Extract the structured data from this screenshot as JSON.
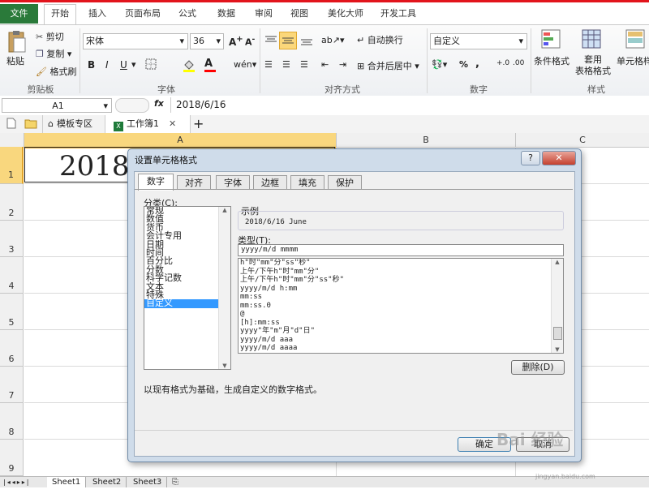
{
  "ribbon": {
    "tabs": [
      "文件",
      "开始",
      "插入",
      "页面布局",
      "公式",
      "数据",
      "审阅",
      "视图",
      "美化大师",
      "开发工具"
    ],
    "clipboard": {
      "paste": "粘贴",
      "cut": "剪切",
      "copy": "复制",
      "format_painter": "格式刷",
      "label": "剪贴板"
    },
    "font": {
      "name": "宋体",
      "size": "36",
      "bold": "B",
      "italic": "I",
      "underline": "U",
      "label": "字体"
    },
    "alignment": {
      "wrap": "自动换行",
      "merge": "合并后居中",
      "label": "对齐方式"
    },
    "number": {
      "format": "自定义",
      "percent": "%",
      "comma": ",",
      "label": "数字"
    },
    "styles": {
      "conditional": "条件格式",
      "table_format": "套用\n表格格式",
      "cell_styles": "单元格样",
      "label": "样式"
    }
  },
  "formula_bar": {
    "name_box": "A1",
    "fx": "fx",
    "value": "2018/6/16"
  },
  "doc_tabs": {
    "template": "模板专区",
    "workbook": "工作簿1",
    "add": "+"
  },
  "grid": {
    "columns": [
      "A",
      "B",
      "C"
    ],
    "rows": [
      "1",
      "2",
      "3",
      "4",
      "5",
      "6",
      "7",
      "8",
      "9"
    ],
    "cell_a1": "2018"
  },
  "sheets": [
    "Sheet1",
    "Sheet2",
    "Sheet3"
  ],
  "dialog": {
    "title": "设置单元格格式",
    "help": "?",
    "close": "✕",
    "tabs": [
      "数字",
      "对齐",
      "字体",
      "边框",
      "填充",
      "保护"
    ],
    "category_label": "分类(C):",
    "categories": [
      "常规",
      "数值",
      "货币",
      "会计专用",
      "日期",
      "时间",
      "百分比",
      "分数",
      "科学记数",
      "文本",
      "特殊",
      "自定义"
    ],
    "selected_category": "自定义",
    "sample_label": "示例",
    "sample_value": "2018/6/16 June",
    "type_label": "类型(T):",
    "type_value": "yyyy/m/d mmmm",
    "formats": [
      "h\"时\"mm\"分\"ss\"秒\"",
      "上午/下午h\"时\"mm\"分\"",
      "上午/下午h\"时\"mm\"分\"ss\"秒\"",
      "yyyy/m/d h:mm",
      "mm:ss",
      "mm:ss.0",
      "@",
      "[h]:mm:ss",
      "yyyy\"年\"m\"月\"d\"日\"",
      "yyyy/m/d aaa",
      "yyyy/m/d aaaa"
    ],
    "delete_label": "删除(D)",
    "description": "以现有格式为基础，生成自定义的数字格式。",
    "ok_label": "确定",
    "cancel_label": "取消"
  },
  "watermark": {
    "brand": "Bai 经验",
    "url": "jingyan.baidu.com"
  }
}
